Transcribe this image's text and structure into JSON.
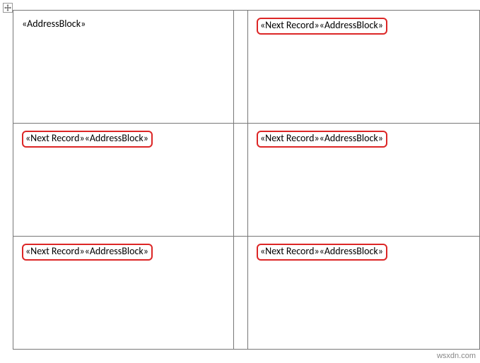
{
  "cells": [
    [
      {
        "text": "«AddressBlock»",
        "highlighted": false
      },
      {
        "text": "«Next Record»«AddressBlock»",
        "highlighted": true
      }
    ],
    [
      {
        "text": "«Next Record»«AddressBlock»",
        "highlighted": true
      },
      {
        "text": "«Next Record»«AddressBlock»",
        "highlighted": true
      }
    ],
    [
      {
        "text": "«Next Record»«AddressBlock»",
        "highlighted": true
      },
      {
        "text": "«Next Record»«AddressBlock»",
        "highlighted": true
      }
    ]
  ],
  "watermark": "wsxdn.com"
}
